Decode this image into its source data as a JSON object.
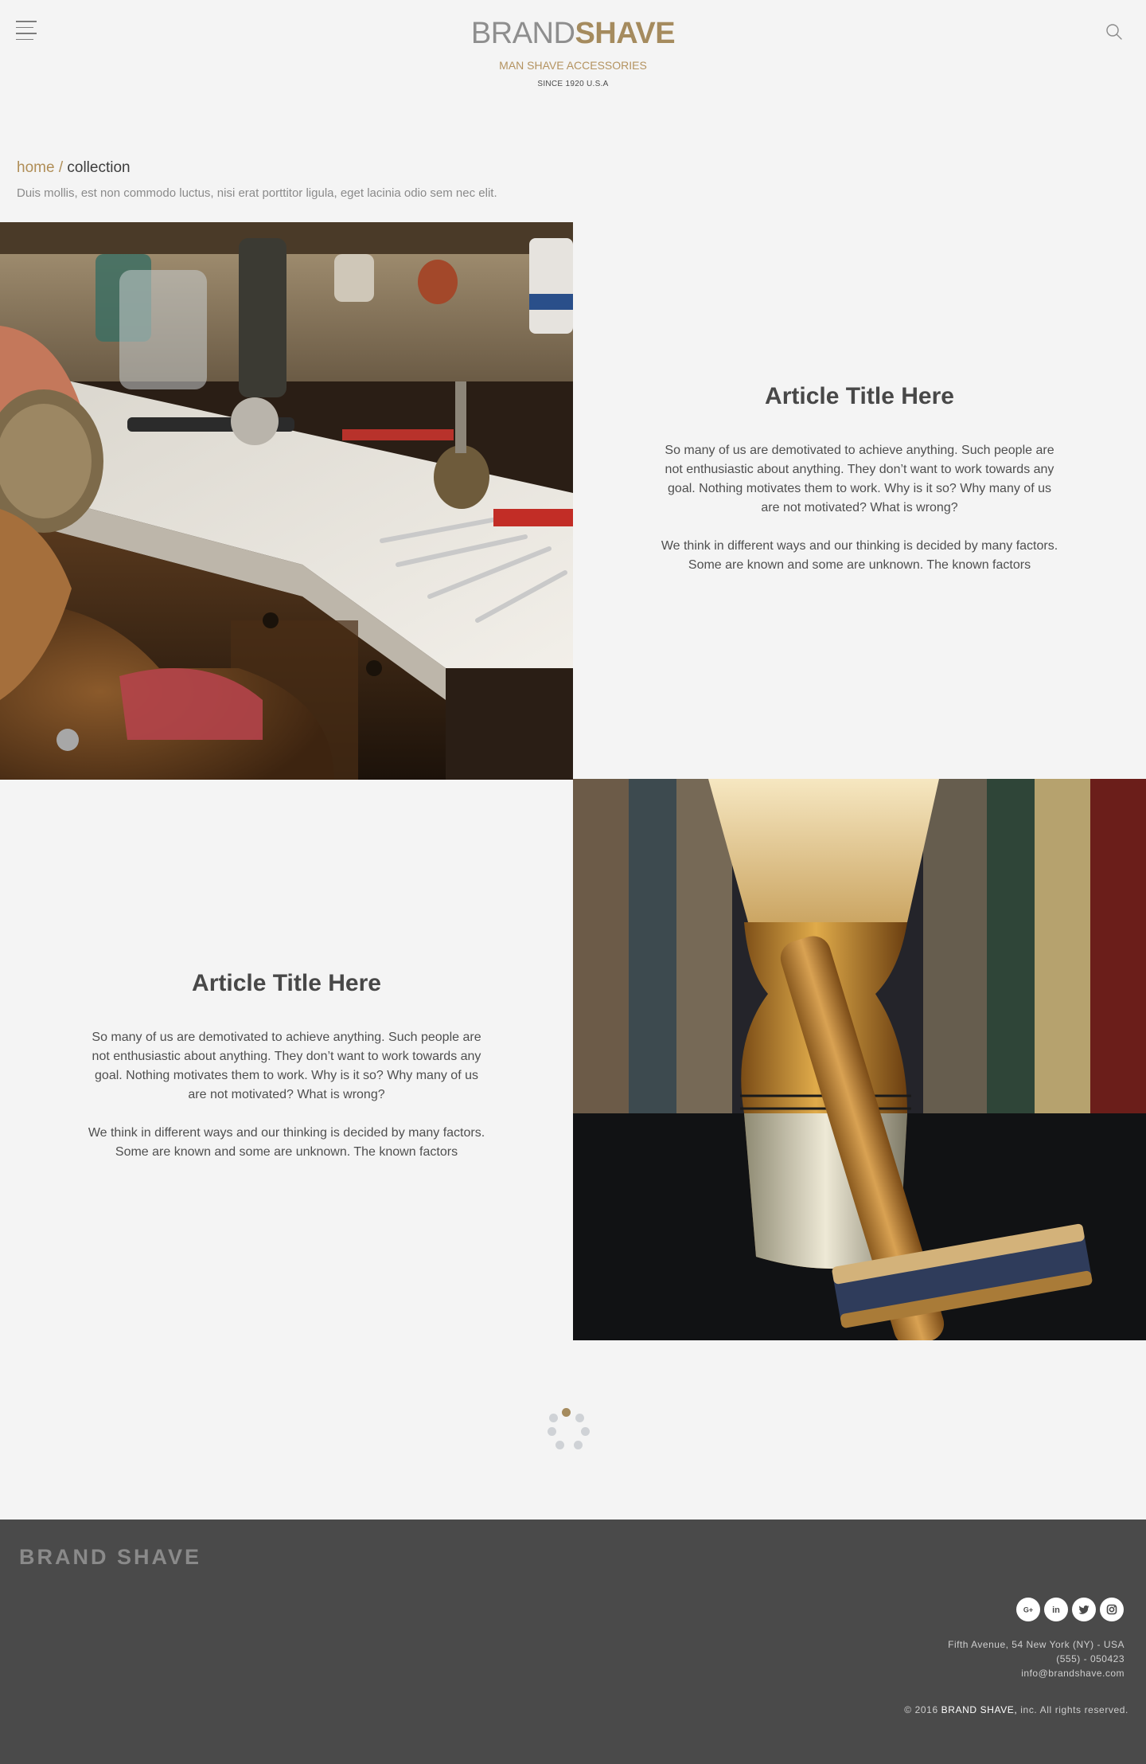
{
  "header": {
    "logo_brand": "BRAND",
    "logo_shave": "SHAVE",
    "tagline": "MAN SHAVE ACCESSORIES",
    "since": "SINCE 1920 U.S.A"
  },
  "breadcrumb": {
    "home": "home",
    "separator": "/",
    "current": "collection",
    "subtitle": "Duis mollis, est non commodo luctus, nisi erat porttitor ligula, eget lacinia odio sem nec elit."
  },
  "articles": [
    {
      "title": "Article Title Here",
      "paragraph_1": "So many of us are demotivated to achieve anything. Such people are not enthusiastic about anything. They don’t want to work towards any goal. Nothing motivates them to work. Why is it so? Why many of us are not motivated? What is wrong?",
      "paragraph_2": "We think in different ways and our thinking is decided by many factors. Some are known and some are unknown. The known factors"
    },
    {
      "title": "Article Title Here",
      "paragraph_1": "So many of us are demotivated to achieve anything. Such people are not enthusiastic about anything. They don’t want to work towards any goal. Nothing motivates them to work. Why is it so? Why many of us are not motivated? What is wrong?",
      "paragraph_2": "We think in different ways and our thinking is decided by many factors. Some are known and some are unknown. The known factors"
    }
  ],
  "footer": {
    "brand": "BRAND SHAVE",
    "socials": [
      "google-plus-icon",
      "linkedin-icon",
      "twitter-icon",
      "instagram-icon"
    ],
    "address_line": "Fifth Avenue, 54 New York (NY) - USA",
    "phone": "(555) - 050423",
    "email": "info@brandshave.com",
    "copyright_prefix": "© 2016",
    "copyright_brand": "BRAND SHAVE,",
    "copyright_suffix": "inc. All rights reserved."
  },
  "colors": {
    "accent": "#a58b5e",
    "background": "#f4f4f4",
    "footer": "#4a4a4a",
    "loader_active": "#a58b5e",
    "loader_inactive": "#cfd2d6"
  }
}
